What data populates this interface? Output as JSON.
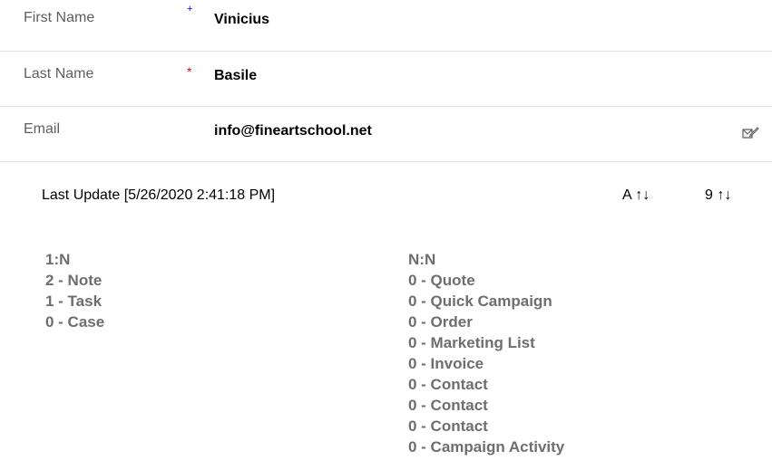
{
  "form": {
    "first_name": {
      "label": "First Name",
      "required_marker": "+",
      "value": "Vinicius"
    },
    "last_name": {
      "label": "Last Name",
      "required_marker": "*",
      "value": "Basile"
    },
    "email": {
      "label": "Email",
      "value": "info@fineartschool.net",
      "action_icon": "compose-email-icon"
    }
  },
  "summary": {
    "last_update": "Last Update [5/26/2020 2:41:18 PM]",
    "sort_alpha": "A ↑↓",
    "sort_numeric": "9 ↑↓"
  },
  "relationships": {
    "one_to_many": {
      "header": "1:N",
      "items": [
        "2 - Note",
        "1 - Task",
        "0 - Case"
      ]
    },
    "many_to_many": {
      "header": "N:N",
      "items": [
        "0 - Quote",
        "0 - Quick Campaign",
        "0 - Order",
        "0 - Marketing List",
        "0 - Invoice",
        "0 - Contact",
        "0 - Contact",
        "0 - Contact",
        "0 - Campaign Activity"
      ]
    }
  },
  "colors": {
    "required_recommended": "#0000c8",
    "required": "#c50f1f",
    "divider": "#e1dfdd",
    "relationship_text": "#6e6e6e"
  }
}
